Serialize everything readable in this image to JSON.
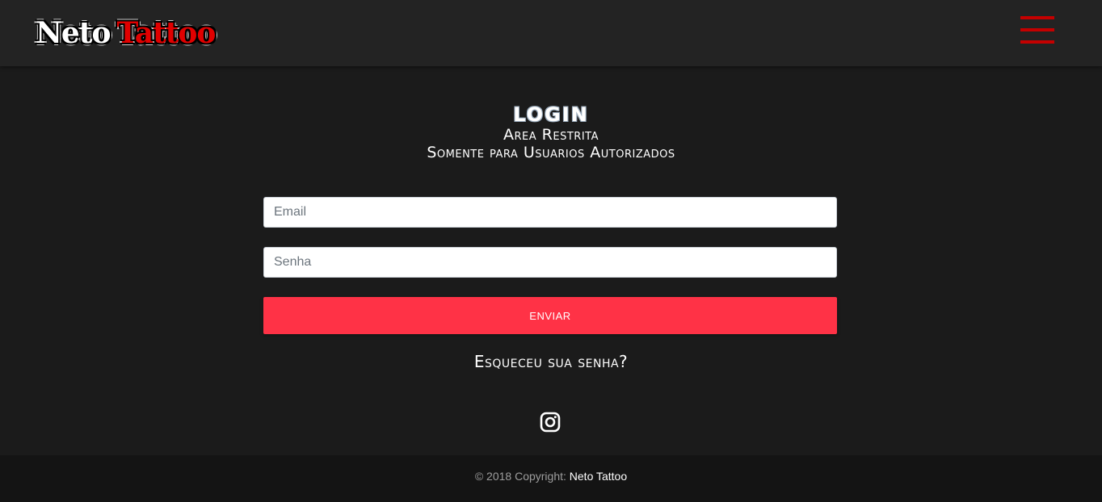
{
  "navbar": {
    "logo_word1": "Neto",
    "logo_word2": "Tattoo",
    "menu_icon": "hamburger-menu-icon",
    "accent_color": "#c40000"
  },
  "login": {
    "title": "LOGIN",
    "subtitle1": "Area Restrita",
    "subtitle2": "Somente para Usuarios Autorizados",
    "email_placeholder": "Email",
    "email_value": "",
    "password_placeholder": "Senha",
    "password_value": "",
    "submit_label": "ENVIAR",
    "submit_color": "#ff3246",
    "forgot_label": "Esqueceu sua senha?"
  },
  "social": {
    "icon": "instagram-icon"
  },
  "footer": {
    "copyright": "© 2018 Copyright:",
    "brand": "Neto Tattoo"
  }
}
